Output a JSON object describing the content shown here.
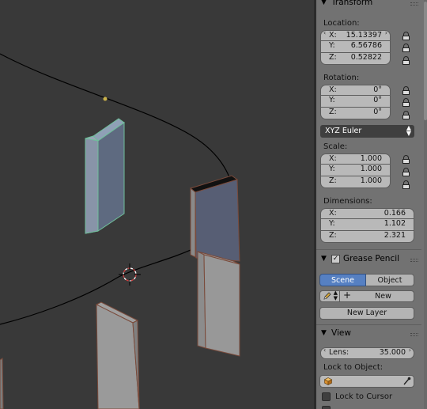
{
  "transform": {
    "title": "Transform",
    "location_label": "Location:",
    "location": [
      {
        "axis": "X:",
        "value": "15.13397"
      },
      {
        "axis": "Y:",
        "value": "6.56786"
      },
      {
        "axis": "Z:",
        "value": "0.52822"
      }
    ],
    "rotation_label": "Rotation:",
    "rotation": [
      {
        "axis": "X:",
        "value": "0°"
      },
      {
        "axis": "Y:",
        "value": "0°"
      },
      {
        "axis": "Z:",
        "value": "0°"
      }
    ],
    "rotation_mode": "XYZ Euler",
    "scale_label": "Scale:",
    "scale": [
      {
        "axis": "X:",
        "value": "1.000"
      },
      {
        "axis": "Y:",
        "value": "1.000"
      },
      {
        "axis": "Z:",
        "value": "1.000"
      }
    ],
    "dimensions_label": "Dimensions:",
    "dimensions": [
      {
        "axis": "X:",
        "value": "0.166"
      },
      {
        "axis": "Y:",
        "value": "1.102"
      },
      {
        "axis": "Z:",
        "value": "2.321"
      }
    ]
  },
  "grease_pencil": {
    "title": "Grease Pencil",
    "enabled_mark": "✓",
    "source_tabs": [
      "Scene",
      "Object"
    ],
    "active_tab": "Scene",
    "new_label": "New",
    "new_layer_label": "New Layer"
  },
  "view": {
    "title": "View",
    "lens_label": "Lens:",
    "lens_value": "35.000",
    "lock_to_object_label": "Lock to Object:",
    "lock_to_cursor_label": "Lock to Cursor"
  },
  "colors": {
    "panel_bg": "#727272",
    "viewport_bg": "#393939",
    "active_tab": "#5680c2",
    "selected_outline": "#6fbf9a",
    "curve": "#000000"
  }
}
